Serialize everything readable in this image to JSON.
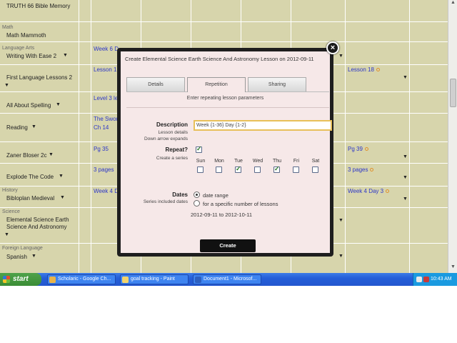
{
  "planner": {
    "rows": [
      {
        "subject": "",
        "course": "TRUTH 66 Bible Memory",
        "cells": []
      },
      {
        "subject": "Math",
        "course": "Math Mammoth",
        "cells": []
      },
      {
        "subject": "Language Arts",
        "course": "Writing With Ease 2",
        "cells": [
          {
            "text": "Week 6 D"
          }
        ]
      },
      {
        "subject": "",
        "course": "First Language Lessons 2",
        "cells": [
          {
            "text": "Lesson 1"
          },
          {
            "text": "Lesson 18"
          }
        ]
      },
      {
        "subject": "",
        "course": "All About Spelling",
        "cells": [
          {
            "text": "Level 3 le"
          }
        ]
      },
      {
        "subject": "",
        "course": "Reading",
        "cells": [
          {
            "text": "The Swor"
          },
          {
            "text": "Ch 14"
          }
        ]
      },
      {
        "subject": "",
        "course": "Zaner Bloser 2c",
        "cells": [
          {
            "text": "Pg 35"
          },
          {
            "text": "Pg 39"
          }
        ]
      },
      {
        "subject": "",
        "course": "Explode The Code",
        "cells": [
          {
            "text": "3 pages"
          },
          {
            "text": "3 pages"
          }
        ]
      },
      {
        "subject": "History",
        "course": "Bibloplan Medieval",
        "cells": [
          {
            "text": "Week 4 D"
          },
          {
            "text": "Week 4 Day 3"
          }
        ]
      },
      {
        "subject": "Science",
        "course_lines": [
          "Elemental Science Earth",
          "Science And Astronomy"
        ],
        "cells": []
      },
      {
        "subject": "Foreign Language",
        "course": "Spanish",
        "cells": []
      }
    ]
  },
  "modal": {
    "title": "Create Elemental Science Earth Science And Astronomy Lesson on 2012-09-11",
    "close_glyph": "×",
    "tabs": [
      "Details",
      "Repetition",
      "Sharing"
    ],
    "active_tab": "Repetition",
    "subtitle": "Enter repeating lesson parameters",
    "description": {
      "label": "Description",
      "sub1": "Lesson details",
      "sub2": "Down arrow expands",
      "value": "Week {1-36} Day {1-2}"
    },
    "repeat": {
      "label": "Repeat?",
      "sub": "Create a series",
      "checked": true,
      "days": [
        {
          "name": "Sun",
          "checked": false
        },
        {
          "name": "Mon",
          "checked": false
        },
        {
          "name": "Tue",
          "checked": true
        },
        {
          "name": "Wed",
          "checked": false
        },
        {
          "name": "Thu",
          "checked": true
        },
        {
          "name": "Fri",
          "checked": false
        },
        {
          "name": "Sat",
          "checked": false
        }
      ]
    },
    "dates": {
      "label": "Dates",
      "sub": "Series included dates",
      "options": [
        "date range",
        "for a specific number of lessons"
      ],
      "selected": "date range",
      "range_text": "2012-09-11 to 2012-10-11"
    },
    "create_label": "Create"
  },
  "taskbar": {
    "start_label": "start",
    "tasks": [
      {
        "label": "Scholaric - Google Ch...",
        "icon_color": "#e8b34a"
      },
      {
        "label": "goal tracking - Paint",
        "icon_color": "#f2d36b"
      },
      {
        "label": "Document1 - Microsof...",
        "icon_color": "#2d5fbf"
      }
    ],
    "clock": "10:43 AM"
  }
}
